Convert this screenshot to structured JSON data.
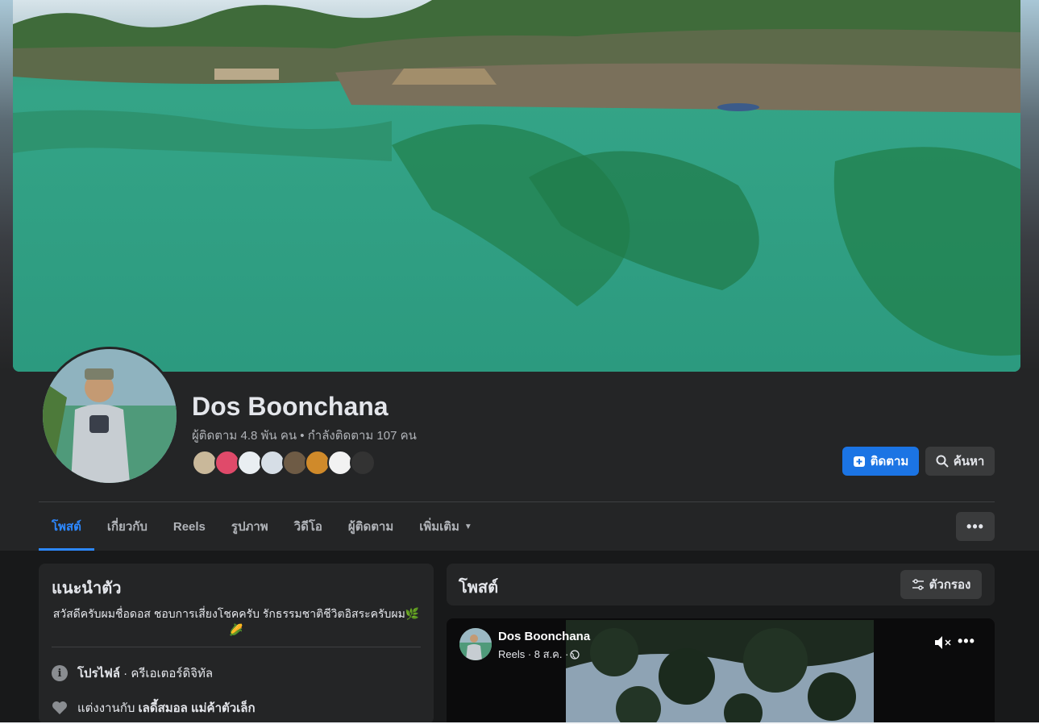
{
  "profile": {
    "name": "Dos Boonchana",
    "stats": "ผู้ติดตาม 4.8 พัน คน • กำลังติดตาม 107 คน",
    "follower_avatar_colors": [
      "#c9b89a",
      "#e04a6a",
      "#e9eef2",
      "#d6dee6",
      "#6e5b45",
      "#d08a2a",
      "#f2f2f2",
      "#333333"
    ]
  },
  "actions": {
    "follow_label": "ติดตาม",
    "search_label": "ค้นหา"
  },
  "tabs": [
    {
      "label": "โพสต์",
      "active": true
    },
    {
      "label": "เกี่ยวกับ",
      "active": false
    },
    {
      "label": "Reels",
      "active": false
    },
    {
      "label": "รูปภาพ",
      "active": false
    },
    {
      "label": "วิดีโอ",
      "active": false
    },
    {
      "label": "ผู้ติดตาม",
      "active": false
    },
    {
      "label": "เพิ่มเติม",
      "active": false
    }
  ],
  "more_menu_icon": "ellipsis-icon",
  "intro": {
    "title": "แนะนำตัว",
    "bio": "สวัสดีครับผมชื่อดอส ชอบการเสี่ยงโชคครับ รักธรรมชาติชีวิตอิสระครับผม🌿🌽",
    "profile_label": "โปรไฟล์",
    "profile_category": " · ครีเอเตอร์ดิจิทัล",
    "relationship_prefix": "แต่งงานกับ ",
    "relationship_name": "เลดี้สมอล แม่ค้าตัวเล็ก"
  },
  "posts": {
    "title": "โพสต์",
    "filter_label": "ตัวกรอง",
    "first_post": {
      "author": "Dos Boonchana",
      "meta": "Reels · 8 ส.ค. ·"
    }
  },
  "colors": {
    "accent": "#2d88ff",
    "follow_button": "#1b74e4",
    "card": "#242526",
    "background": "#18191a"
  }
}
